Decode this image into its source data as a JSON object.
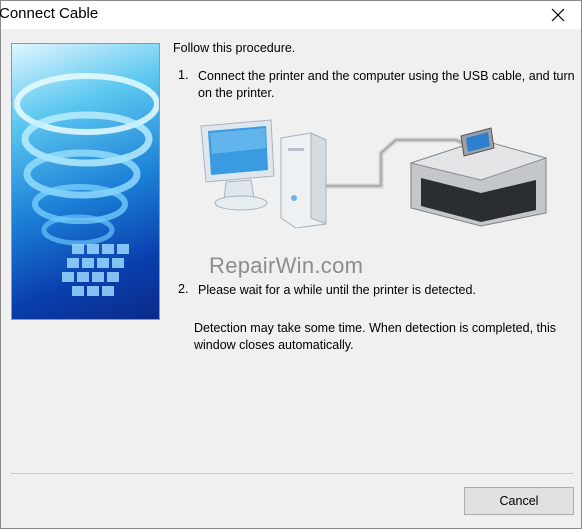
{
  "window": {
    "title": "Connect Cable"
  },
  "content": {
    "intro": "Follow this procedure.",
    "steps": [
      {
        "number": "1.",
        "text": "Connect the printer and the computer using the USB cable, and turn on the printer."
      },
      {
        "number": "2.",
        "text": "Please wait for a while until the printer is detected."
      }
    ],
    "note": "Detection may take some time. When detection is completed, this window closes automatically.",
    "watermark": "RepairWin.com"
  },
  "buttons": {
    "cancel": "Cancel"
  },
  "icons": {
    "close": "close-icon"
  },
  "colors": {
    "background": "#f0f0f0",
    "title_bar": "#ffffff",
    "side_panel": "#1b7fd6"
  }
}
